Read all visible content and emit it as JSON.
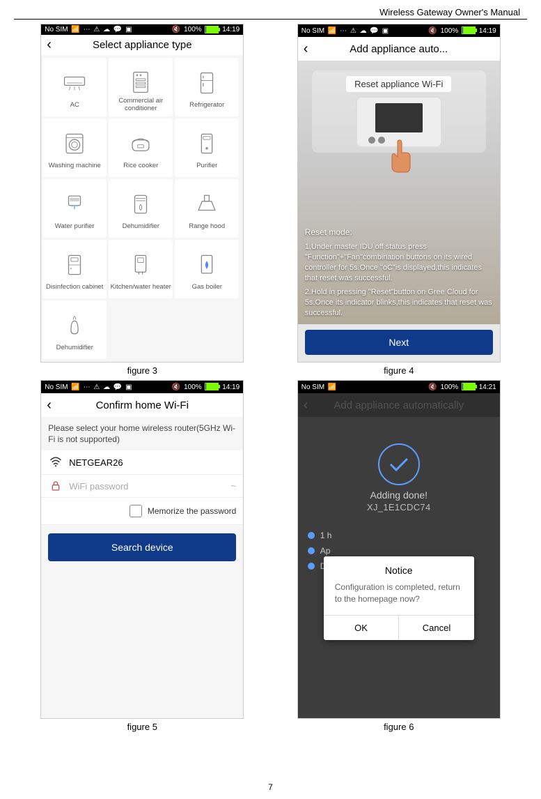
{
  "doc": {
    "title": "Wireless Gateway Owner's Manual",
    "page_number": "7"
  },
  "captions": {
    "f3": "figure 3",
    "f4": "figure 4",
    "f5": "figure 5",
    "f6": "figure 6"
  },
  "status": {
    "no_sim": "No SIM",
    "battery_pct": "100%",
    "time": "14:19",
    "time2": "14:21"
  },
  "fig3": {
    "title": "Select appliance type",
    "items": [
      {
        "name": "ac",
        "label": "AC"
      },
      {
        "name": "commercial-ac",
        "label": "Commercial air conditioner"
      },
      {
        "name": "refrigerator",
        "label": "Refrigerator"
      },
      {
        "name": "washing-machine",
        "label": "Washing machine"
      },
      {
        "name": "rice-cooker",
        "label": "Rice cooker"
      },
      {
        "name": "purifier",
        "label": "Purifier"
      },
      {
        "name": "water-purifier",
        "label": "Water purifier"
      },
      {
        "name": "dehumidifier",
        "label": "Dehumidifier"
      },
      {
        "name": "range-hood",
        "label": "Range hood"
      },
      {
        "name": "disinfection-cabinet",
        "label": "Disinfection cabinet"
      },
      {
        "name": "kitchen-water-heater",
        "label": "Kitchen/water heater"
      },
      {
        "name": "gas-boiler",
        "label": "Gas boiler"
      },
      {
        "name": "dehumidifier2",
        "label": "Dehumidifier"
      }
    ]
  },
  "fig4": {
    "title": "Add appliance auto...",
    "reset_title": "Reset appliance Wi-Fi",
    "reset_mode_header": "Reset mode:",
    "step1": "1.Under master IDU off status,press \"Function\"+\"Fan\"combination buttons on its wired controller for 5s.Once \"oC\"is displayed,this indicates that reset was successful.",
    "step2": "2.Hold in pressing \"Reset\"button on Gree Cloud for 5s.Once its indicator blinks,this indicates that reset was successful.",
    "next": "Next"
  },
  "fig5": {
    "title": "Confirm home Wi-Fi",
    "note": "Please select your home wireless router(5GHz Wi-Fi is not supported)",
    "ssid": "NETGEAR26",
    "password_placeholder": "WiFi password",
    "memorize": "Memorize the password",
    "search": "Search device"
  },
  "fig6": {
    "title": "Add appliance automatically",
    "done": "Adding done!",
    "device": "XJ_1E1CDC74",
    "list": {
      "l1": "1 h",
      "l2": "Ap",
      "l3": "Do"
    },
    "dialog": {
      "title": "Notice",
      "msg": "Configuration is completed, return to the homepage now?",
      "ok": "OK",
      "cancel": "Cancel"
    }
  },
  "icons": {
    "ac": "<svg viewBox='0 0 40 40'><rect x='3' y='10' width='34' height='14' rx='2' fill='none' stroke='#888' stroke-width='1.5'/><line x1='7' y1='20' x2='33' y2='20' stroke='#888'/><line x1='13' y1='26' x2='11' y2='32' stroke='#888'/><line x1='20' y1='26' x2='20' y2='32' stroke='#888'/><line x1='27' y1='26' x2='29' y2='32' stroke='#888'/></svg>",
    "commercial-ac": "<svg viewBox='0 0 40 40'><rect x='8' y='3' width='24' height='34' rx='2' fill='none' stroke='#888' stroke-width='1.5'/><circle cx='14' cy='8' r='1.5' fill='#888'/><circle cx='20' cy='8' r='1.5' fill='#888'/><rect x='12' y='14' width='16' height='3' fill='none' stroke='#888'/><rect x='12' y='20' width='16' height='3' fill='none' stroke='#888'/><rect x='12' y='26' width='16' height='3' fill='none' stroke='#888'/></svg>",
    "refrigerator": "<svg viewBox='0 0 40 40'><rect x='10' y='3' width='20' height='34' rx='2' fill='none' stroke='#888' stroke-width='1.5'/><line x1='10' y1='16' x2='30' y2='16' stroke='#888'/><line x1='14' y1='8' x2='14' y2='12' stroke='#888' stroke-width='1.5'/><line x1='14' y1='20' x2='14' y2='26' stroke='#888' stroke-width='1.5'/></svg>",
    "washing-machine": "<svg viewBox='0 0 40 40'><rect x='6' y='4' width='28' height='32' rx='3' fill='none' stroke='#888' stroke-width='1.5'/><circle cx='20' cy='22' r='9' fill='none' stroke='#888' stroke-width='1.5'/><circle cx='20' cy='22' r='5' fill='none' stroke='#888'/><line x1='6' y1='10' x2='34' y2='10' stroke='#888'/></svg>",
    "rice-cooker": "<svg viewBox='0 0 40 40'><rect x='6' y='14' width='28' height='18' rx='6' fill='none' stroke='#888' stroke-width='1.5'/><path d='M6 18 Q20 6 34 18' fill='none' stroke='#888' stroke-width='1.5'/><rect x='15' y='22' width='10' height='5' rx='1' fill='none' stroke='#888'/></svg>",
    "purifier": "<svg viewBox='0 0 40 40'><rect x='11' y='4' width='18' height='32' rx='2' fill='none' stroke='#888' stroke-width='1.5'/><rect x='14' y='8' width='12' height='5' rx='1' fill='none' stroke='#888'/><circle cx='20' cy='28' r='2' fill='#888'/></svg>",
    "water-purifier": "<svg viewBox='0 0 40 40'><rect x='10' y='6' width='20' height='16' rx='2' fill='none' stroke='#888' stroke-width='1.5'/><rect x='12' y='9' width='16' height='6' rx='1' fill='#888' opacity='0.4'/><line x1='16' y1='22' x2='16' y2='24' stroke='#6bf' stroke-width='2'/><line x1='20' y1='22' x2='20' y2='28' stroke='#6bf' stroke-width='2'/><line x1='24' y1='22' x2='24' y2='24' stroke='#6bf' stroke-width='2'/></svg>",
    "dehumidifier": "<svg viewBox='0 0 40 40'><rect x='10' y='5' width='20' height='30' rx='3' fill='none' stroke='#888' stroke-width='1.5'/><line x1='12' y1='10' x2='28' y2='10' stroke='#888'/><line x1='12' y1='14' x2='28' y2='14' stroke='#888'/><path d='M20 20 Q16 26 20 30 Q24 26 20 20' fill='none' stroke='#888'/></svg>",
    "range-hood": "<svg viewBox='0 0 40 40'><rect x='16' y='5' width='8' height='10' fill='none' stroke='#888' stroke-width='1.5'/><path d='M6 30 L12 15 L28 15 L34 30 Z' fill='none' stroke='#888' stroke-width='1.5'/></svg>",
    "disinfection-cabinet": "<svg viewBox='0 0 40 40'><rect x='10' y='4' width='20' height='32' rx='2' fill='none' stroke='#888' stroke-width='1.5'/><line x1='10' y1='20' x2='30' y2='20' stroke='#888'/><rect x='14' y='8' width='12' height='6' rx='1' fill='none' stroke='#888'/><circle cx='14' cy='26' r='1' fill='#888'/></svg>",
    "kitchen-water-heater": "<svg viewBox='0 0 40 40'><rect x='11' y='4' width='18' height='28' rx='2' fill='none' stroke='#888' stroke-width='1.5'/><rect x='15' y='8' width='10' height='8' rx='1' fill='none' stroke='#888'/><line x1='17' y1='32' x2='17' y2='36' stroke='#888' stroke-width='1.5'/><line x1='23' y1='32' x2='23' y2='36' stroke='#888' stroke-width='1.5'/></svg>",
    "gas-boiler": "<svg viewBox='0 0 40 40'><rect x='11' y='4' width='18' height='30' rx='2' fill='none' stroke='#888' stroke-width='1.5'/><path d='M20 14 Q16 20 20 26 Q24 20 20 14' fill='#58f' stroke='#58f'/></svg>",
    "dehumidifier2": "<svg viewBox='0 0 40 40'><path d='M14 28 Q14 12 20 12 Q26 12 26 28 Q26 34 20 34 Q14 34 14 28' fill='none' stroke='#888' stroke-width='1.5'/><path d='M18 10 Q18 6 20 4' fill='none' stroke='#888'/><path d='M22 10 Q22 6 20 4' fill='none' stroke='#888'/></svg>"
  }
}
